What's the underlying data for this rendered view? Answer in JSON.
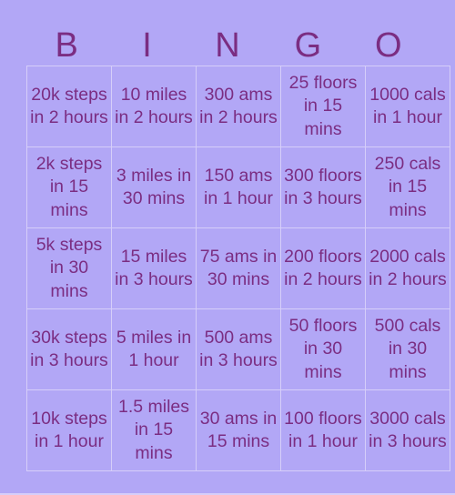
{
  "header": {
    "letters": [
      "B",
      "I",
      "N",
      "G",
      "O"
    ]
  },
  "colors": {
    "background": "#b2a7f6",
    "text": "#7b2d82",
    "grid": "#d6cef9"
  },
  "board": {
    "rows": [
      [
        "20k steps in 2 hours",
        "10 miles in 2 hours",
        "300 ams in 2 hours",
        "25 floors in 15 mins",
        "1000 cals in 1 hour"
      ],
      [
        "2k steps in 15 mins",
        "3 miles in 30 mins",
        "150 ams in 1 hour",
        "300 floors in 3 hours",
        "250 cals in 15 mins"
      ],
      [
        "5k steps in 30 mins",
        "15 miles in 3 hours",
        "75 ams in 30 mins",
        "200 floors in 2 hours",
        "2000 cals in 2 hours"
      ],
      [
        "30k steps in 3 hours",
        "5 miles in 1 hour",
        "500 ams in 3 hours",
        "50 floors in 30 mins",
        "500 cals in 30 mins"
      ],
      [
        "10k steps in 1 hour",
        "1.5 miles in 15 mins",
        "30 ams in 15 mins",
        "100 floors in 1 hour",
        "3000 cals in 3 hours"
      ]
    ]
  }
}
